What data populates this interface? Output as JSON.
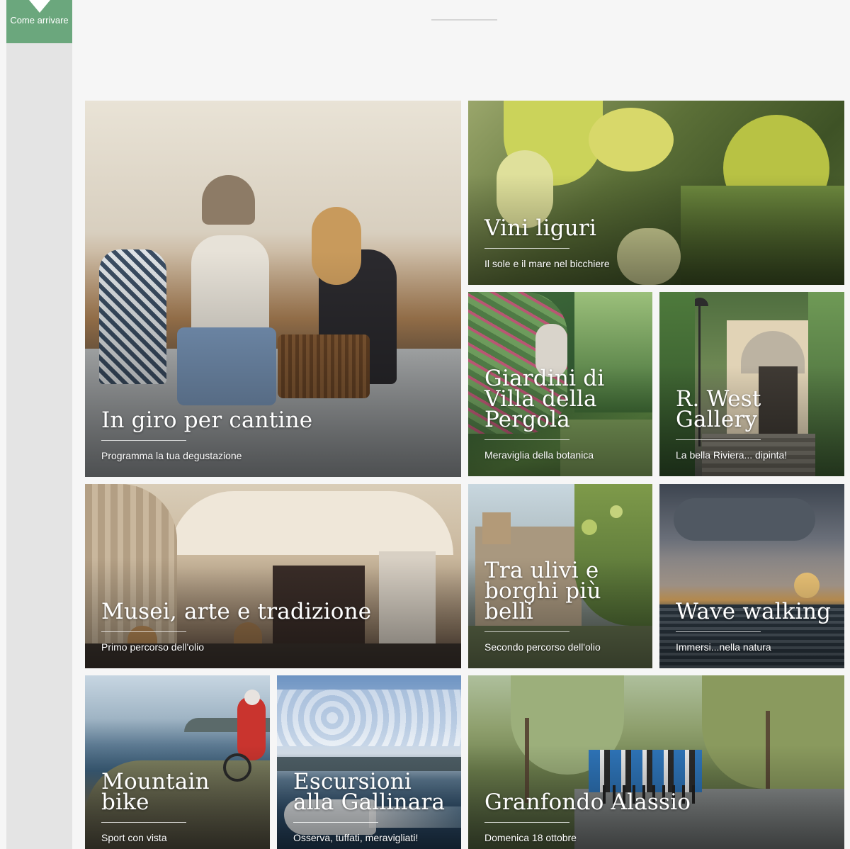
{
  "sidebar": {
    "come_arrivare": "Come arrivare"
  },
  "tiles": [
    {
      "title": "In giro per cantine",
      "subtitle": "Programma la tua degustazione"
    },
    {
      "title": "Vini liguri",
      "subtitle": "Il sole e il mare nel bicchiere"
    },
    {
      "title": "Giardini di Villa della Pergola",
      "subtitle": "Meraviglia della botanica"
    },
    {
      "title": "R. West Gallery",
      "subtitle": "La bella Riviera... dipinta!"
    },
    {
      "title": "Musei, arte e tradizione",
      "subtitle": "Primo percorso dell'olio"
    },
    {
      "title": "Tra ulivi e borghi più belli",
      "subtitle": "Secondo percorso dell'olio"
    },
    {
      "title": "Wave walking",
      "subtitle": "Immersi...nella natura"
    },
    {
      "title": "Mountain bike",
      "subtitle": "Sport con vista"
    },
    {
      "title": "Escursioni alla Gallinara",
      "subtitle": "Osserva, tuffati, meravigliati!"
    },
    {
      "title": "Granfondo Alassio",
      "subtitle": "Domenica 18 ottobre"
    }
  ],
  "colors": {
    "accent": "#6ba77d",
    "sidebar": "#e4e4e4",
    "background": "#f6f6f6"
  },
  "icons": {
    "come_arrivare": "chevron-down-icon"
  }
}
